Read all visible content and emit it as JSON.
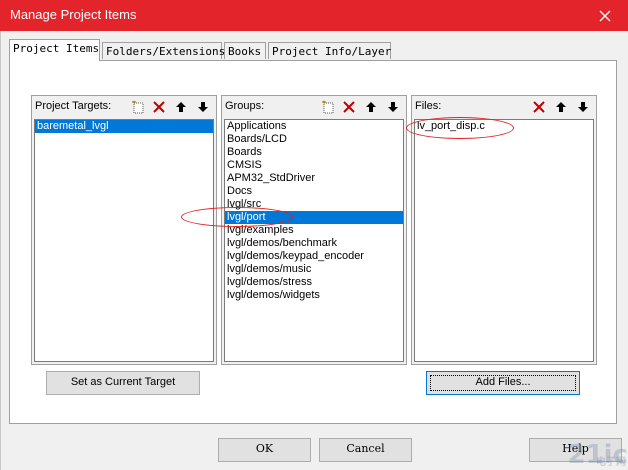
{
  "window": {
    "title": "Manage Project Items"
  },
  "tabs": [
    {
      "label": "Project Items"
    },
    {
      "label": "Folders/Extensions"
    },
    {
      "label": "Books"
    },
    {
      "label": "Project Info/Layer"
    }
  ],
  "targets": {
    "label": "Project Targets:",
    "items": [
      "baremetal_lvgl"
    ],
    "selected_index": 0
  },
  "groups": {
    "label": "Groups:",
    "items": [
      "Applications",
      "Boards/LCD",
      "Boards",
      "CMSIS",
      "APM32_StdDriver",
      "Docs",
      "lvgl/src",
      "lvgl/port",
      "lvgl/examples",
      "lvgl/demos/benchmark",
      "lvgl/demos/keypad_encoder",
      "lvgl/demos/music",
      "lvgl/demos/stress",
      "lvgl/demos/widgets"
    ],
    "selected_index": 7
  },
  "files": {
    "label": "Files:",
    "items": [
      "lv_port_disp.c"
    ]
  },
  "buttons": {
    "set_target": "Set as Current Target",
    "add_files": "Add Files...",
    "ok": "OK",
    "cancel": "Cancel",
    "help": "Help"
  },
  "watermark": {
    "main": "21ic",
    "sub": "电子网"
  },
  "colors": {
    "titlebar": "#e3242b",
    "selection": "#0078d7",
    "annotation": "#e02020"
  }
}
